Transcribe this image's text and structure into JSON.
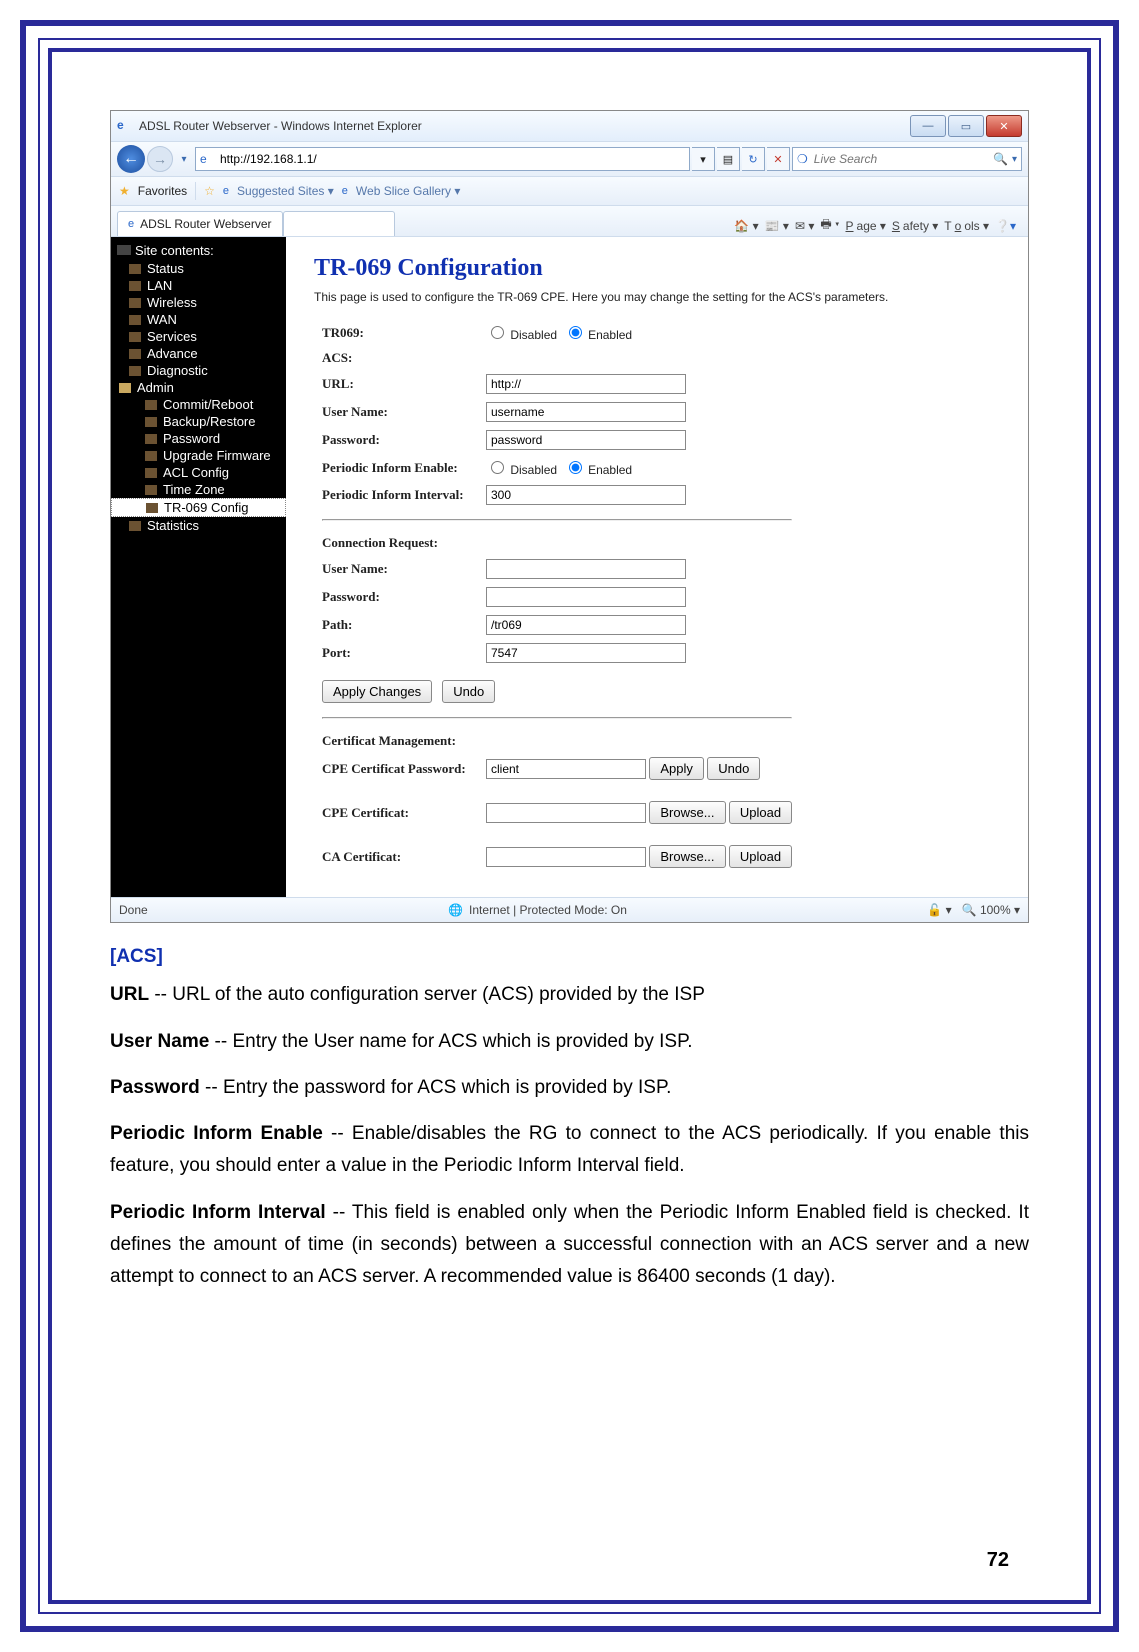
{
  "ie": {
    "title": "ADSL Router Webserver - Windows Internet Explorer",
    "url": "http://192.168.1.1/",
    "search_placeholder": "Live Search",
    "favorites_label": "Favorites",
    "suggested_sites": "Suggested Sites",
    "web_slice": "Web Slice Gallery",
    "tab_title": "ADSL Router Webserver",
    "cmd_page": "Page",
    "cmd_safety": "Safety",
    "cmd_tools": "Tools",
    "status_done": "Done",
    "status_zone": "Internet | Protected Mode: On",
    "status_zoom": "100%"
  },
  "sidebar": {
    "title": "Site contents:",
    "items": [
      "Status",
      "LAN",
      "Wireless",
      "WAN",
      "Services",
      "Advance",
      "Diagnostic",
      "Admin"
    ],
    "admin_children": [
      "Commit/Reboot",
      "Backup/Restore",
      "Password",
      "Upgrade Firmware",
      "ACL Config",
      "Time Zone",
      "TR-069 Config"
    ],
    "last": "Statistics"
  },
  "page": {
    "heading": "TR-069 Configuration",
    "desc": "This page is used to configure the TR-069 CPE. Here you may change the setting for the ACS's parameters.",
    "labels": {
      "tr069": "TR069:",
      "acs": "ACS:",
      "url": "URL:",
      "username": "User Name:",
      "password": "Password:",
      "pie": "Periodic Inform Enable:",
      "pii": "Periodic Inform Interval:",
      "conn_req": "Connection Request:",
      "path": "Path:",
      "port": "Port:",
      "certmgmt": "Certificat Management:",
      "cpe_cert_pw": "CPE Certificat Password:",
      "cpe_cert": "CPE Certificat:",
      "ca_cert": "CA Certificat:"
    },
    "values": {
      "url": "http://",
      "username": "username",
      "password": "password",
      "interval": "300",
      "path": "/tr069",
      "port": "7547",
      "cert_pw": "client"
    },
    "radio": {
      "disabled": "Disabled",
      "enabled": "Enabled"
    },
    "buttons": {
      "apply_changes": "Apply Changes",
      "undo": "Undo",
      "apply": "Apply",
      "browse": "Browse...",
      "upload": "Upload"
    }
  },
  "doc": {
    "section": "[ACS]",
    "p1a": "URL",
    "p1b": " -- URL of the auto configuration server (ACS) provided by the ISP",
    "p2a": "User Name",
    "p2b": " -- Entry the User name for ACS which is provided by ISP.",
    "p3a": "Password",
    "p3b": " -- Entry the password for ACS which is provided by ISP.",
    "p4a": "Periodic Inform Enable",
    "p4b": " -- Enable/disables the RG to connect to the ACS periodically. If you enable this feature, you should enter a value in the Periodic Inform Interval field.",
    "p5a": "Periodic Inform Interval",
    "p5b": " -- This field is enabled only when the Periodic Inform Enabled field is checked. It defines the amount of time (in seconds) between a successful connection with an ACS server and a new attempt to connect to an ACS server. A recommended value is 86400 seconds (1 day).",
    "pagenum": "72"
  }
}
